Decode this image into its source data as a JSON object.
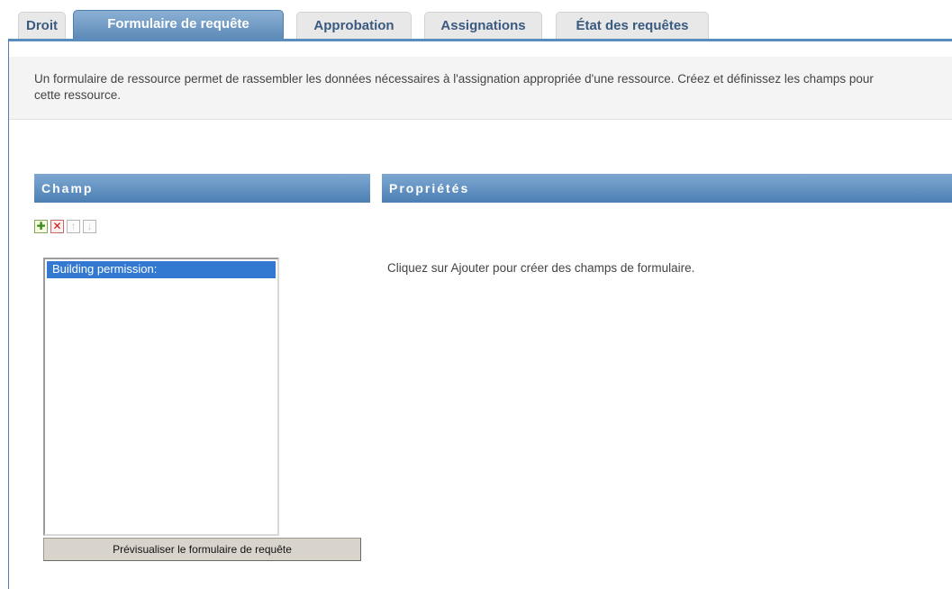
{
  "tabs": [
    {
      "label": "Droit",
      "active": false
    },
    {
      "label": "Formulaire de requête",
      "active": true
    },
    {
      "label": "Approbation",
      "active": false
    },
    {
      "label": "Assignations",
      "active": false
    },
    {
      "label": "État des requêtes",
      "active": false
    }
  ],
  "description": "Un formulaire de ressource permet de rassembler les données nécessaires à l'assignation appropriée d'une ressource. Créez et définissez les champs pour cette ressource.",
  "field_panel": {
    "header": "Champ",
    "toolbar": {
      "add_icon": "add-icon",
      "delete_icon": "delete-icon",
      "move_up_icon": "move-up-icon",
      "move_down_icon": "move-down-icon"
    },
    "items": [
      "Building permission:"
    ],
    "preview_button": "Prévisualiser le formulaire de requête"
  },
  "properties_panel": {
    "header": "Propriétés",
    "hint": "Cliquez sur Ajouter pour créer des champs de formulaire."
  },
  "colors": {
    "accent": "#5a8cc0",
    "selection": "#3379d1",
    "header_gradient_top": "#7ea8d2",
    "header_gradient_bottom": "#4c7fb3"
  }
}
